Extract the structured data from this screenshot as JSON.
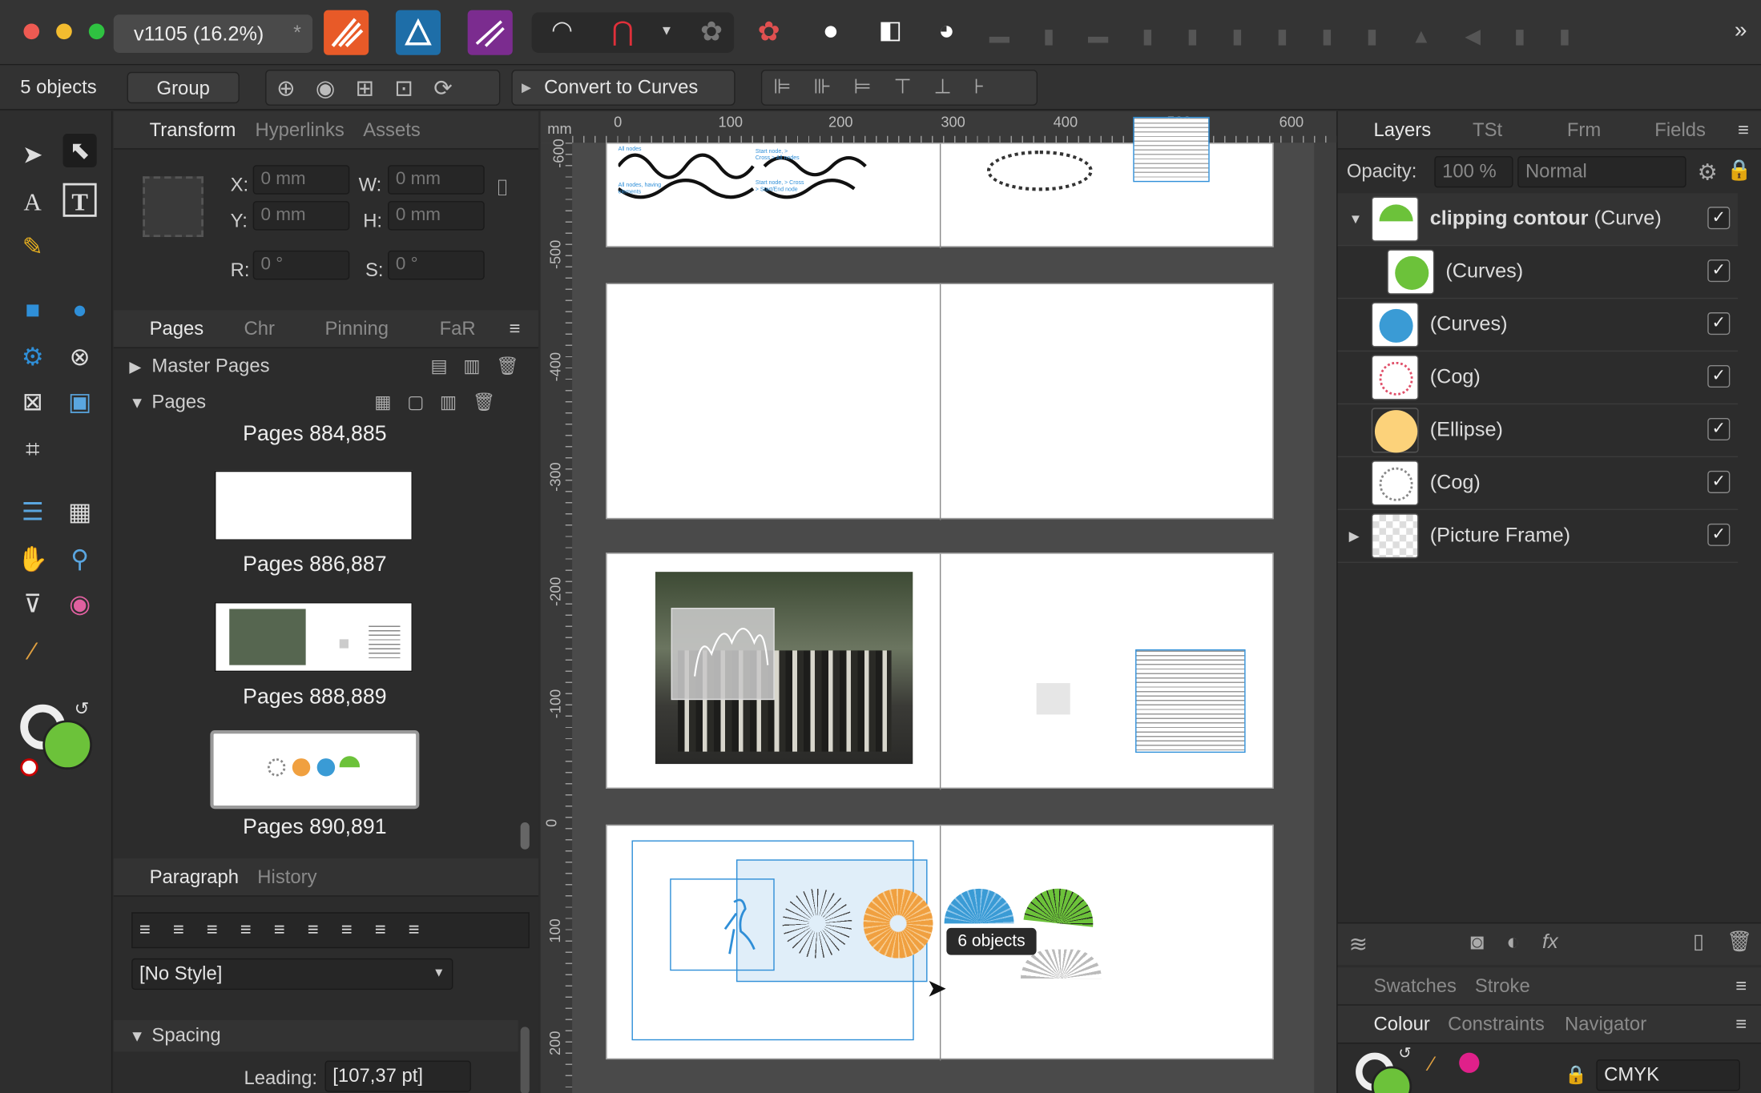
{
  "document": {
    "tab_title": "v1105  (16.2%)",
    "modified_mark": "*"
  },
  "context": {
    "selection": "5 objects",
    "group_button": "Group",
    "convert_button": "Convert to Curves"
  },
  "transform_panel": {
    "tabs": [
      "Transform",
      "Hyperlinks",
      "Assets"
    ],
    "x_label": "X:",
    "x_value": "0 mm",
    "y_label": "Y:",
    "y_value": "0 mm",
    "w_label": "W:",
    "w_value": "0 mm",
    "h_label": "H:",
    "h_value": "0 mm",
    "r_label": "R:",
    "r_value": "0 °",
    "s_label": "S:",
    "s_value": "0 °"
  },
  "pages_panel": {
    "tabs": [
      "Pages",
      "Chr",
      "Pinning",
      "FaR"
    ],
    "master_pages": "Master Pages",
    "pages": "Pages",
    "items": [
      "Pages 884,885",
      "Pages 886,887",
      "Pages 888,889",
      "Pages 890,891"
    ]
  },
  "paragraph_panel": {
    "tabs": [
      "Paragraph",
      "History"
    ],
    "style_value": "[No Style]",
    "spacing": "Spacing",
    "leading_label": "Leading:",
    "leading_value": "[107,37 pt]"
  },
  "ruler": {
    "unit": "mm",
    "h_ticks": [
      "0",
      "100",
      "200",
      "300",
      "400",
      "500",
      "600"
    ],
    "v_ticks": [
      "-600",
      "-500",
      "-400",
      "-300",
      "-200",
      "-100",
      "0",
      "100",
      "200"
    ]
  },
  "canvas": {
    "tooltip": "6 objects",
    "small_text_1": "All nodes",
    "small_text_2": "All nodes, having elements",
    "small_text_3": "Start node, > Cross > All nodes",
    "small_text_4": "Start node, > Cross > Start/End node"
  },
  "layers_panel": {
    "tabs": [
      "Layers",
      "TSt",
      "Frm",
      "Fields"
    ],
    "opacity_label": "Opacity:",
    "opacity_value": "100 %",
    "blend_value": "Normal",
    "rows": [
      {
        "name": "clipping contour",
        "type": "(Curve)"
      },
      {
        "name": "(Curves)"
      },
      {
        "name": "(Curves)"
      },
      {
        "name": "(Cog)"
      },
      {
        "name": "(Ellipse)"
      },
      {
        "name": "(Cog)"
      },
      {
        "name": "(Picture Frame)"
      }
    ],
    "check": "✓"
  },
  "swatches_panel": {
    "tabs": [
      "Swatches",
      "Stroke"
    ]
  },
  "colour_panel": {
    "tabs": [
      "Colour",
      "Constraints",
      "Navigator"
    ],
    "mode_value": "CMYK"
  },
  "colors": {
    "accent": "#2f8fd8",
    "green": "#6cc23a",
    "orange": "#f0a040",
    "blue": "#3a9bd5",
    "red": "#e0506a"
  }
}
